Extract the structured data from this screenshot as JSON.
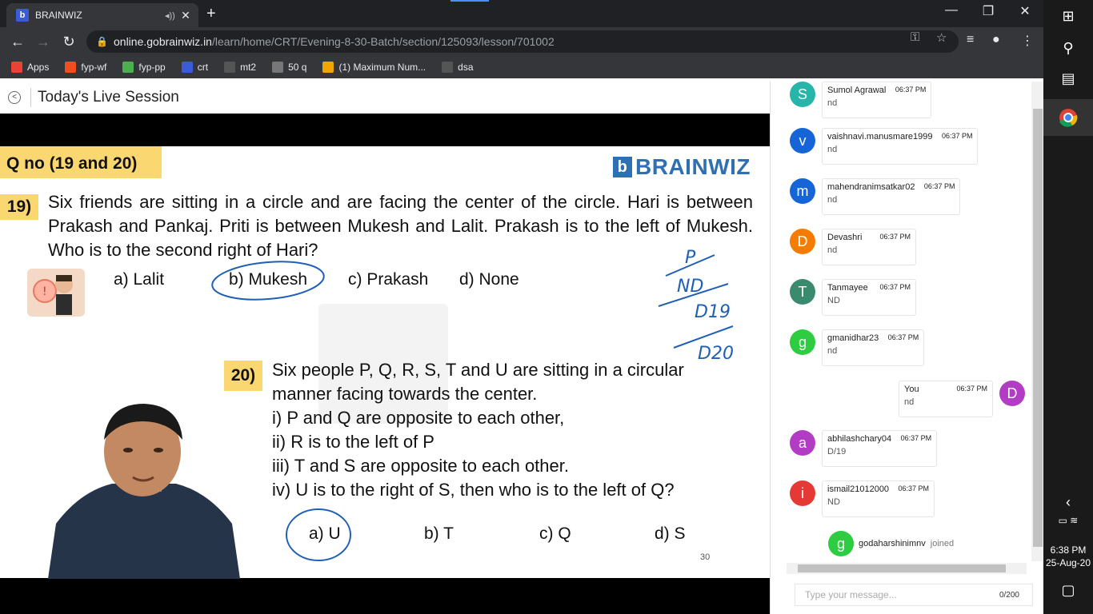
{
  "browser": {
    "tab_title": "BRAINWIZ",
    "favicon_letter": "b",
    "url_host": "online.gobrainwiz.in",
    "url_path": "/learn/home/CRT/Evening-8-30-Batch/section/125093/lesson/701002",
    "bookmarks": [
      {
        "label": "Apps",
        "icon": "apps-grid-icon",
        "color": "#ea4335"
      },
      {
        "label": "fyp-wf",
        "icon": "figma-icon",
        "color": "#f24e1e"
      },
      {
        "label": "fyp-pp",
        "icon": "image-icon",
        "color": "#4caf50"
      },
      {
        "label": "crt",
        "icon": "brainwiz-icon",
        "color": "#3b5bdb"
      },
      {
        "label": "mt2",
        "icon": "cc-icon",
        "color": "#555555"
      },
      {
        "label": "50 q",
        "icon": "globe-icon",
        "color": "#777777"
      },
      {
        "label": "(1) Maximum Num...",
        "icon": "codeforces-icon",
        "color": "#f0a500"
      },
      {
        "label": "dsa",
        "icon": "cc-icon",
        "color": "#555555"
      }
    ]
  },
  "page": {
    "title": "Today's Live Session"
  },
  "slide": {
    "qno_label": "Q no (19 and 20)",
    "logo_text": "BRAINWIZ",
    "q19_num": "19)",
    "q19_text": "Six friends are sitting in a circle and are facing the center of the circle. Hari is between Prakash and Pankaj. Priti is between Mukesh and Lalit. Prakash is to the left of Mukesh. Who is to the second right of Hari?",
    "q19_options": [
      "a) Lalit",
      "b) Mukesh",
      "c) Prakash",
      "d) None"
    ],
    "q20_num": "20)",
    "q20_lines": [
      "Six people P, Q, R, S, T and U are sitting in a circular",
      "manner facing towards the center.",
      "i)    P and Q are opposite to each other,",
      "ii)   R is to the left of P",
      "iii)  T and S are opposite to each other.",
      "iv)  U is to the right of S,  then who is to the left of Q?"
    ],
    "q20_options": [
      "a) U",
      "b) T",
      "c) Q",
      "d) S"
    ],
    "page_number": "30",
    "handwriting": [
      "P",
      "ND",
      "D19",
      "D20"
    ]
  },
  "chat": {
    "messages": [
      {
        "initial": "S",
        "name": "Sumol Agrawal",
        "time": "06:37 PM",
        "text": "nd",
        "color": "#26b5a8"
      },
      {
        "initial": "v",
        "name": "vaishnavi.manusmare1999",
        "time": "06:37 PM",
        "text": "nd",
        "color": "#1565d8"
      },
      {
        "initial": "m",
        "name": "mahendranimsatkar02",
        "time": "06:37 PM",
        "text": "nd",
        "color": "#1565d8"
      },
      {
        "initial": "D",
        "name": "Devashri",
        "time": "06:37 PM",
        "text": "nd",
        "color": "#f57c00"
      },
      {
        "initial": "T",
        "name": "Tanmayee",
        "time": "06:37 PM",
        "text": "ND",
        "color": "#3a8a6e"
      },
      {
        "initial": "g",
        "name": "gmanidhar23",
        "time": "06:37 PM",
        "text": "nd",
        "color": "#2ecc40"
      },
      {
        "initial": "D",
        "name": "You",
        "time": "06:37 PM",
        "text": "nd",
        "color": "#b23cc4",
        "self": true
      },
      {
        "initial": "a",
        "name": "abhilashchary04",
        "time": "06:37 PM",
        "text": "D/19",
        "color": "#b23cc4"
      },
      {
        "initial": "i",
        "name": "ismail21012000",
        "time": "06:37 PM",
        "text": "ND",
        "color": "#e53935"
      }
    ],
    "joined": {
      "initial": "g",
      "name": "godaharshinimnv",
      "text": "joined"
    },
    "input_placeholder": "Type your message...",
    "char_count": "0/200"
  },
  "taskbar": {
    "time": "6:38 PM",
    "date": "25-Aug-20"
  }
}
